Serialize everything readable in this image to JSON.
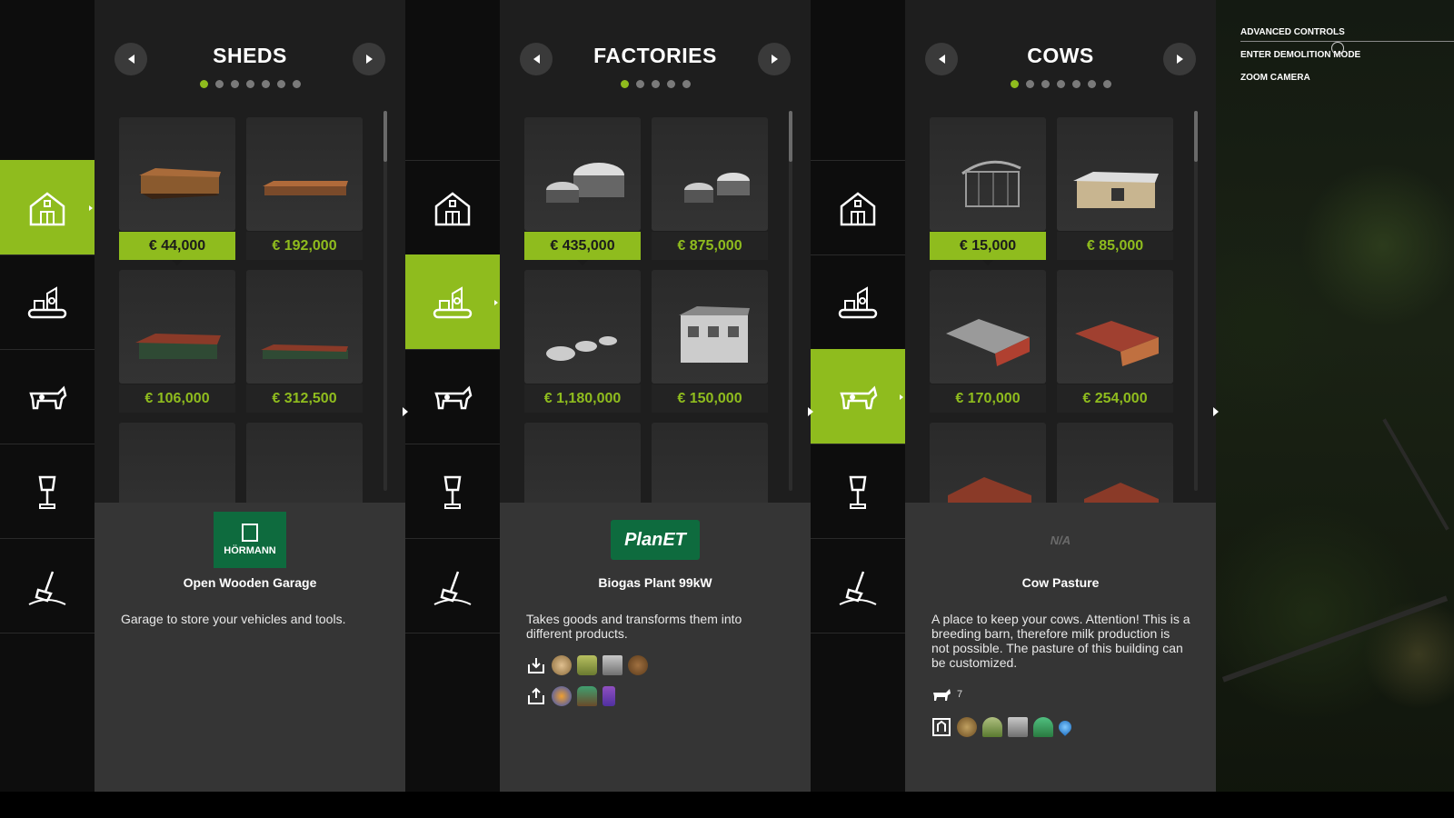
{
  "hints": [
    "ADVANCED CONTROLS",
    "ENTER DEMOLITION MODE",
    "ZOOM CAMERA"
  ],
  "sidebar_icons": [
    "barn-icon",
    "factory-icon",
    "cow-icon",
    "lamp-icon",
    "shovel-icon"
  ],
  "panels": [
    {
      "title": "SHEDS",
      "dots": 7,
      "active_dot": 0,
      "items": [
        {
          "price": "€ 44,000",
          "selected": true
        },
        {
          "price": "€ 192,000",
          "selected": false
        },
        {
          "price": "€ 106,000",
          "selected": false
        },
        {
          "price": "€ 312,500",
          "selected": false
        }
      ],
      "brand": "HÖRMANN",
      "name": "Open Wooden Garage",
      "description": "Garage to store your vehicles and tools."
    },
    {
      "title": "FACTORIES",
      "dots": 5,
      "active_dot": 0,
      "items": [
        {
          "price": "€ 435,000",
          "selected": true
        },
        {
          "price": "€ 875,000",
          "selected": false
        },
        {
          "price": "€ 1,180,000",
          "selected": false
        },
        {
          "price": "€ 150,000",
          "selected": false
        }
      ],
      "brand": "PlanET",
      "name": "Biogas Plant 99kW",
      "description": "Takes goods and transforms them into different products."
    },
    {
      "title": "COWS",
      "dots": 7,
      "active_dot": 0,
      "items": [
        {
          "price": "€ 15,000",
          "selected": true
        },
        {
          "price": "€ 85,000",
          "selected": false
        },
        {
          "price": "€ 170,000",
          "selected": false
        },
        {
          "price": "€ 254,000",
          "selected": false
        }
      ],
      "brand": "N/A",
      "name": "Cow Pasture",
      "description": "A place to keep your cows. Attention! This is a breeding barn, therefore milk production is not possible. The pasture of this building can be customized.",
      "capacity": "7"
    }
  ],
  "colors": {
    "accent": "#8fbc1e"
  }
}
